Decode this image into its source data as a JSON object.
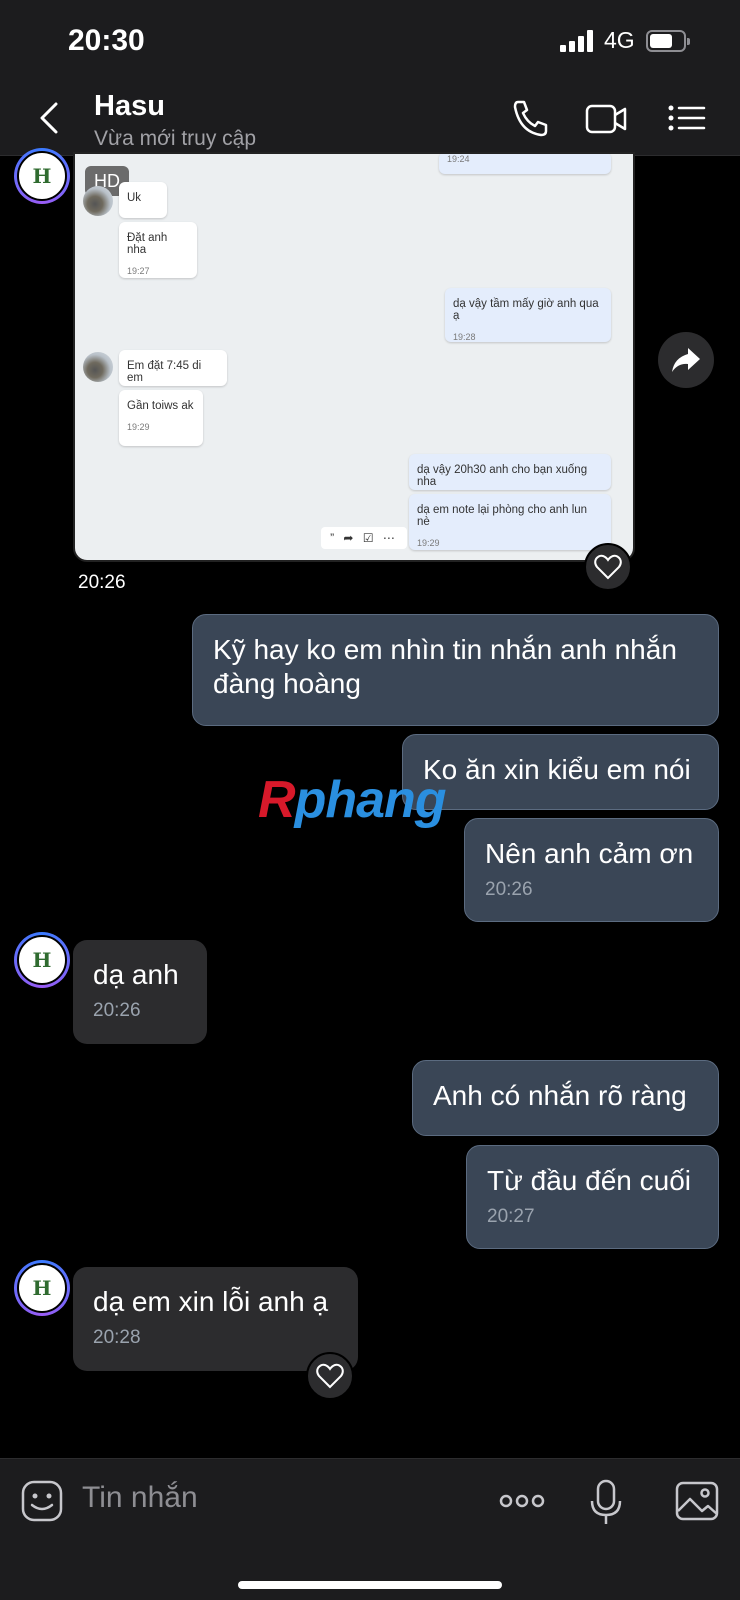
{
  "status_bar": {
    "time": "20:30",
    "network": "4G"
  },
  "header": {
    "name": "Hasu",
    "status": "Vừa mới truy cập"
  },
  "avatar_text": "H",
  "image_message": {
    "badge": "HD",
    "time": "20:26",
    "top_time": "19:24",
    "m1": "Uk",
    "m2": "Đặt anh nha",
    "m2_time": "19:27",
    "m3": "dạ vậy tầm mấy giờ anh qua ạ",
    "m3_time": "19:28",
    "m4": "Em đặt 7:45 di em",
    "m5": "Gần toiws ak",
    "m5_time": "19:29",
    "m6": "dạ vậy 20h30 anh cho bạn xuống nha",
    "m7": "dạ em note lại phòng cho anh lun nè",
    "m7_time": "19:29",
    "actions": "” ➦ ☑ ⋯"
  },
  "messages": {
    "b1": "Kỹ hay ko em nhìn tin nhắn anh nhắn đàng hoàng",
    "b2": "Ko ăn xin kiểu em nói",
    "b3": "Nên anh cảm ơn",
    "b3_time": "20:26",
    "b4": "dạ anh",
    "b4_time": "20:26",
    "b5": "Anh có nhắn rõ ràng",
    "b6": "Từ đầu đến cuối",
    "b6_time": "20:27",
    "b7": "dạ em xin lỗi anh ạ",
    "b7_time": "20:28"
  },
  "watermark": {
    "first": "R",
    "rest": "phang"
  },
  "composer": {
    "placeholder": "Tin nhắn"
  },
  "icons": [
    "back-icon",
    "phone-icon",
    "video-icon",
    "menu-icon",
    "share-icon",
    "heart-icon",
    "sticker-icon",
    "more-icon",
    "mic-icon",
    "image-icon"
  ]
}
